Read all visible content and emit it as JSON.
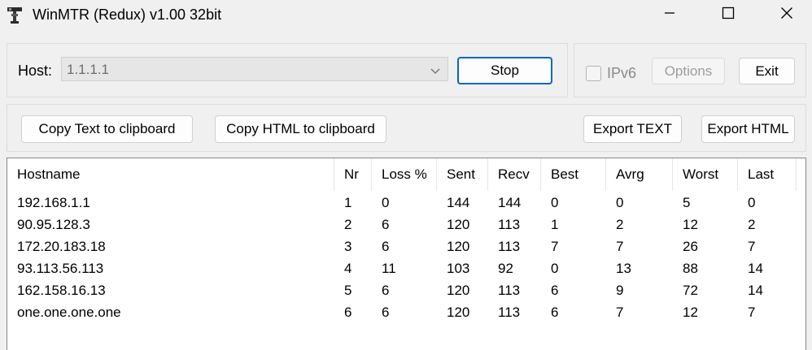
{
  "window": {
    "title": "WinMTR (Redux) v1.00 32bit",
    "icon": "winmtr-app-icon"
  },
  "host": {
    "label": "Host:",
    "value": "1.1.1.1"
  },
  "controls": {
    "stop_label": "Stop",
    "ipv6_label": "IPv6",
    "ipv6_checked": false,
    "options_label": "Options",
    "exit_label": "Exit"
  },
  "export": {
    "copy_text_label": "Copy Text to clipboard",
    "copy_html_label": "Copy HTML to clipboard",
    "export_text_label": "Export TEXT",
    "export_html_label": "Export HTML"
  },
  "table": {
    "columns": [
      "Hostname",
      "Nr",
      "Loss %",
      "Sent",
      "Recv",
      "Best",
      "Avrg",
      "Worst",
      "Last"
    ],
    "rows": [
      [
        "192.168.1.1",
        "1",
        "0",
        "144",
        "144",
        "0",
        "0",
        "5",
        "0"
      ],
      [
        "90.95.128.3",
        "2",
        "6",
        "120",
        "113",
        "1",
        "2",
        "12",
        "2"
      ],
      [
        "172.20.183.18",
        "3",
        "6",
        "120",
        "113",
        "7",
        "7",
        "26",
        "7"
      ],
      [
        "93.113.56.113",
        "4",
        "11",
        "103",
        "92",
        "0",
        "13",
        "88",
        "14"
      ],
      [
        "162.158.16.13",
        "5",
        "6",
        "120",
        "113",
        "6",
        "9",
        "72",
        "14"
      ],
      [
        "one.one.one.one",
        "6",
        "6",
        "120",
        "113",
        "6",
        "7",
        "12",
        "7"
      ]
    ]
  },
  "colors": {
    "accent": "#0067c0",
    "window_bg": "#f0f0f0",
    "list_bg": "#ffffff"
  }
}
